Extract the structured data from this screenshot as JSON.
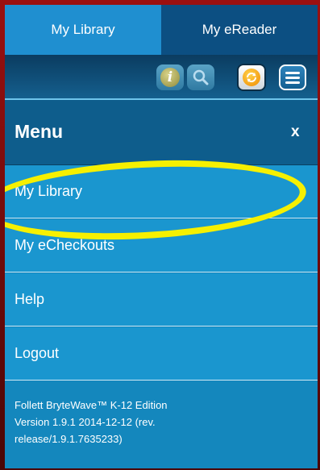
{
  "tabs": [
    {
      "label": "My Library",
      "active": true
    },
    {
      "label": "My eReader",
      "active": false
    }
  ],
  "toolbar": {
    "info_glyph": "i",
    "icons": [
      "info-icon",
      "search-icon",
      "sync-icon",
      "menu-icon"
    ]
  },
  "menu": {
    "title": "Menu",
    "close_label": "x",
    "items": [
      {
        "label": "My Library"
      },
      {
        "label": "My eCheckouts"
      },
      {
        "label": "Help"
      },
      {
        "label": "Logout"
      }
    ],
    "version_lines": [
      "Follett BryteWave™ K-12 Edition",
      "Version 1.9.1 2014-12-12 (rev.",
      "release/1.9.1.7635233)"
    ]
  },
  "colors": {
    "tab_active": "#1f8fd0",
    "tab_inactive": "#0c4f82",
    "menu_header": "#0e5d8c",
    "menu_item": "#1a96cf",
    "highlight": "#f6f000",
    "frame": "#7a0e0e"
  }
}
